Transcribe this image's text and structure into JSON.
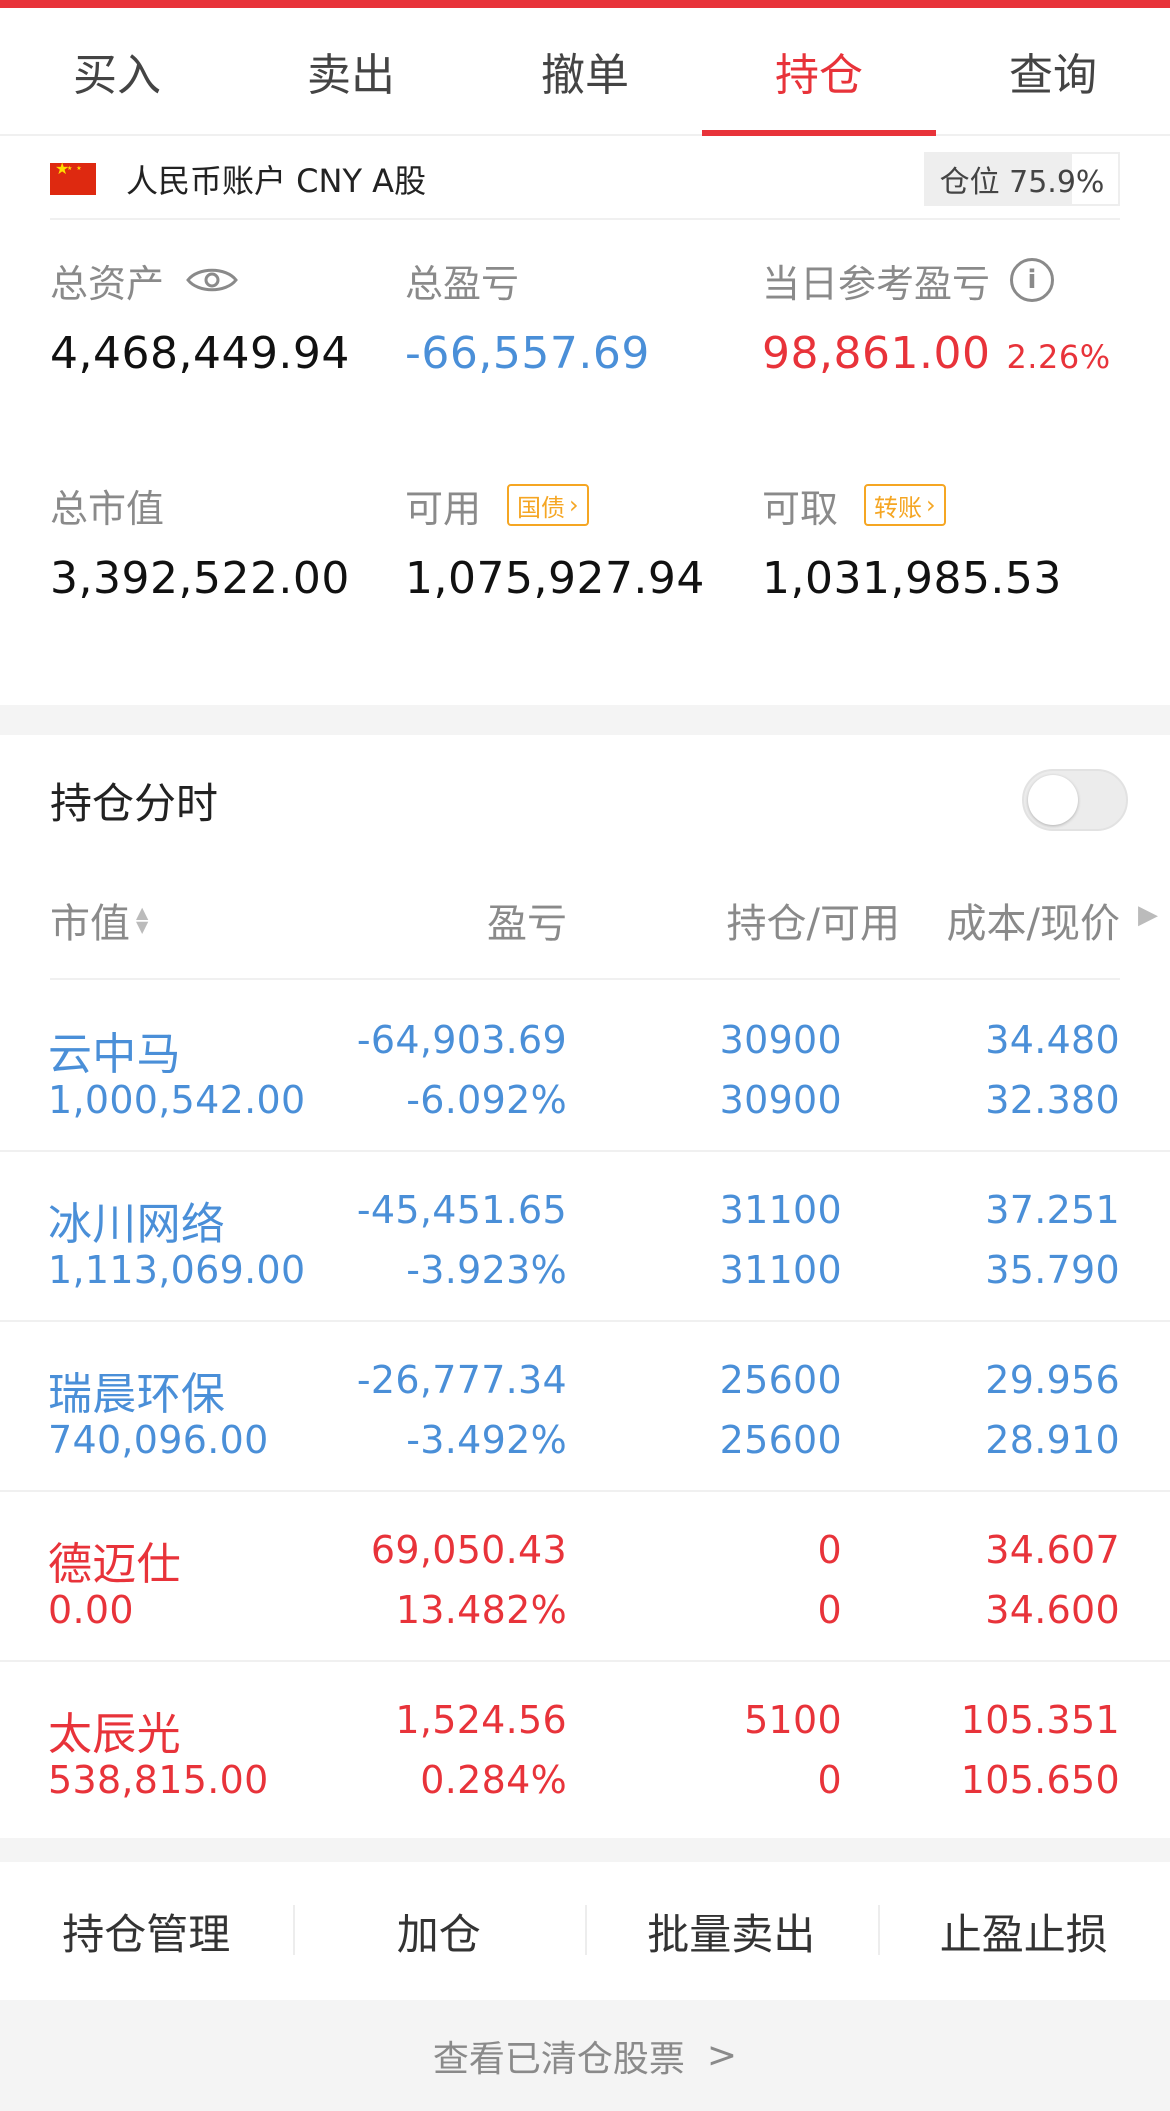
{
  "colors": {
    "accent": "#e8333a",
    "down": "#4a8fd8",
    "tag": "#f5a623"
  },
  "tabs": [
    {
      "label": "买入",
      "active": false
    },
    {
      "label": "卖出",
      "active": false
    },
    {
      "label": "撤单",
      "active": false
    },
    {
      "label": "持仓",
      "active": true
    },
    {
      "label": "查询",
      "active": false
    }
  ],
  "account": {
    "name": "人民币账户 CNY A股",
    "position_label": "仓位 75.9%",
    "position_ratio": 0.759
  },
  "assets": {
    "total_assets": {
      "label": "总资产",
      "value": "4,468,449.94"
    },
    "total_pl": {
      "label": "总盈亏",
      "value": "-66,557.69"
    },
    "daily_pl": {
      "label": "当日参考盈亏",
      "value": "98,861.00",
      "pct": "2.26%"
    },
    "market_value": {
      "label": "总市值",
      "value": "3,392,522.00"
    },
    "available": {
      "label": "可用",
      "tag": "国债",
      "value": "1,075,927.94"
    },
    "withdrawable": {
      "label": "可取",
      "tag": "转账",
      "value": "1,031,985.53"
    }
  },
  "toggle": {
    "label": "持仓分时",
    "on": false
  },
  "table": {
    "headers": {
      "market_value": "市值",
      "pl": "盈亏",
      "position": "持仓/可用",
      "cost": "成本/现价"
    },
    "rows": [
      {
        "name": "云中马",
        "market_value": "1,000,542.00",
        "pl": "-64,903.69",
        "pl_pct": "-6.092%",
        "position": "30900",
        "available": "30900",
        "cost": "34.480",
        "price": "32.380",
        "trend": "down"
      },
      {
        "name": "冰川网络",
        "market_value": "1,113,069.00",
        "pl": "-45,451.65",
        "pl_pct": "-3.923%",
        "position": "31100",
        "available": "31100",
        "cost": "37.251",
        "price": "35.790",
        "trend": "down"
      },
      {
        "name": "瑞晨环保",
        "market_value": "740,096.00",
        "pl": "-26,777.34",
        "pl_pct": "-3.492%",
        "position": "25600",
        "available": "25600",
        "cost": "29.956",
        "price": "28.910",
        "trend": "down"
      },
      {
        "name": "德迈仕",
        "market_value": "0.00",
        "pl": "69,050.43",
        "pl_pct": "13.482%",
        "position": "0",
        "available": "0",
        "cost": "34.607",
        "price": "34.600",
        "trend": "up"
      },
      {
        "name": "太辰光",
        "market_value": "538,815.00",
        "pl": "1,524.56",
        "pl_pct": "0.284%",
        "position": "5100",
        "available": "0",
        "cost": "105.351",
        "price": "105.650",
        "trend": "up"
      }
    ]
  },
  "actions": [
    "持仓管理",
    "加仓",
    "批量卖出",
    "止盈止损"
  ],
  "footer": {
    "label": "查看已清仓股票",
    "chevron": ">"
  }
}
